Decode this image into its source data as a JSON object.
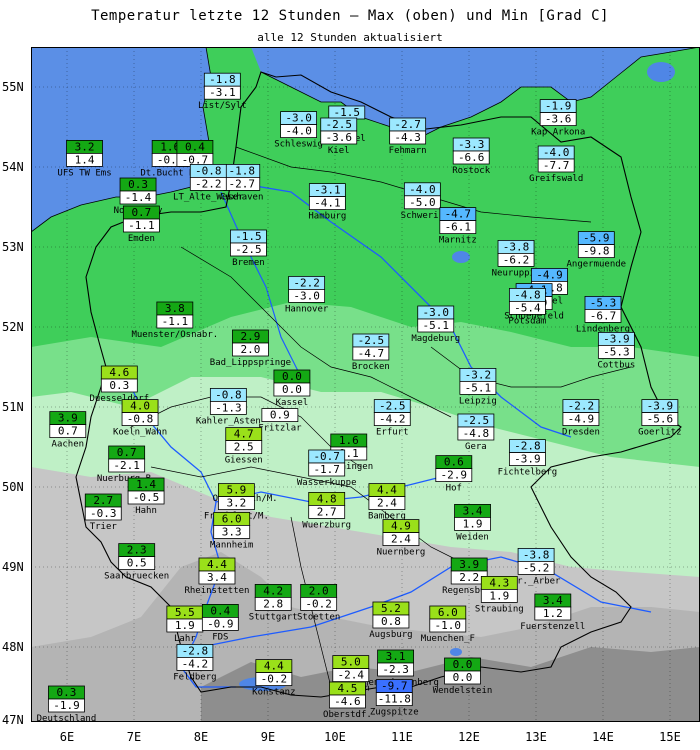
{
  "title": "Temperatur letzte 12 Stunden — Max (oben) und Min [Grad C]",
  "subtitle": "alle 12 Stunden aktualisiert",
  "lat_labels": [
    "55N",
    "54N",
    "53N",
    "52N",
    "51N",
    "50N",
    "49N",
    "48N",
    "47N"
  ],
  "lon_labels": [
    "6E",
    "7E",
    "8E",
    "9E",
    "10E",
    "11E",
    "12E",
    "13E",
    "14E",
    "15E"
  ],
  "colors": {
    "sea": "#5b8fe6",
    "land_green": "#3fce5a",
    "land_green_light": "#78e08a",
    "land_pale": "#bff0c6",
    "land_grey": "#c6c6c6",
    "land_dark": "#8e8e8e",
    "lake": "#4f86e6",
    "border": "#000000",
    "river": "#1e5cff",
    "max_bg_warm_strong": "#14a814",
    "max_bg_warm": "#9ae01a",
    "max_bg_cold": "#9ce8ff",
    "max_bg_colder": "#55b8ff",
    "max_bg_coldest": "#3a70ff"
  },
  "stations": [
    {
      "name": "List/Sylt",
      "max": "-1.8",
      "min": "-3.1",
      "cat": "cold",
      "lon": 8.41,
      "lat": 55.01
    },
    {
      "name": "UFS TW Ems",
      "max": "3.2",
      "min": "1.4",
      "cat": "warm_strong",
      "lon": 6.35,
      "lat": 54.17
    },
    {
      "name": "Dt.Bucht H.",
      "max": "1.6",
      "min": "-0.2",
      "cat": "warm_strong",
      "lon": 7.63,
      "lat": 54.17
    },
    {
      "name": "",
      "max": "0.4",
      "min": "-0.7",
      "cat": "warm_strong",
      "lon": 8.0,
      "lat": 54.17
    },
    {
      "name": "Schleswig",
      "max": "-3.0",
      "min": "-4.0",
      "cat": "cold",
      "lon": 9.55,
      "lat": 54.53
    },
    {
      "name": "LT_Kiel",
      "max": "-1.5",
      "min": "",
      "cat": "cold",
      "lon": 10.27,
      "lat": 54.6
    },
    {
      "name": "Kiel",
      "max": "-2.5",
      "min": "-3.6",
      "cat": "cold",
      "lon": 10.15,
      "lat": 54.45
    },
    {
      "name": "Fehmarn",
      "max": "-2.7",
      "min": "-4.3",
      "cat": "cold",
      "lon": 11.18,
      "lat": 54.45
    },
    {
      "name": "Kap Arkona",
      "max": "-1.9",
      "min": "-3.6",
      "cat": "cold",
      "lon": 13.43,
      "lat": 54.68
    },
    {
      "name": "Rostock",
      "max": "-3.3",
      "min": "-6.6",
      "cat": "cold",
      "lon": 12.13,
      "lat": 54.2
    },
    {
      "name": "Greifswald",
      "max": "-4.0",
      "min": "-7.7",
      "cat": "cold",
      "lon": 13.4,
      "lat": 54.1
    },
    {
      "name": "Cuxhaven",
      "max": "-1.8",
      "min": "-2.7",
      "cat": "cold",
      "lon": 8.7,
      "lat": 53.87
    },
    {
      "name": "LT_Alte_Weser",
      "max": "-0.8",
      "min": "-2.2",
      "cat": "cold",
      "lon": 8.2,
      "lat": 53.87
    },
    {
      "name": "Norderney",
      "max": "0.3",
      "min": "-1.4",
      "cat": "warm_strong",
      "lon": 7.15,
      "lat": 53.7
    },
    {
      "name": "Emden",
      "max": "0.7",
      "min": "-1.1",
      "cat": "warm_strong",
      "lon": 7.2,
      "lat": 53.35
    },
    {
      "name": "Hamburg",
      "max": "-3.1",
      "min": "-4.1",
      "cat": "cold",
      "lon": 9.98,
      "lat": 53.63
    },
    {
      "name": "Schwerin",
      "max": "-4.0",
      "min": "-5.0",
      "cat": "cold",
      "lon": 11.4,
      "lat": 53.64
    },
    {
      "name": "Marnitz",
      "max": "-4.7",
      "min": "-6.1",
      "cat": "colder",
      "lon": 11.93,
      "lat": 53.33
    },
    {
      "name": "Neuruppin",
      "max": "-3.8",
      "min": "-6.2",
      "cat": "cold",
      "lon": 12.8,
      "lat": 52.92
    },
    {
      "name": "Angermuende",
      "max": "-5.9",
      "min": "-9.8",
      "cat": "colder",
      "lon": 14.0,
      "lat": 53.03
    },
    {
      "name": "Bremen",
      "max": "-1.5",
      "min": "-2.5",
      "cat": "cold",
      "lon": 8.8,
      "lat": 53.05
    },
    {
      "name": "Tegel",
      "max": "-4.9",
      "min": "-5.8",
      "cat": "colder",
      "lon": 13.3,
      "lat": 52.57
    },
    {
      "name": "Schoenefeld",
      "max": "-4.1",
      "min": "-5.9",
      "cat": "colder",
      "lon": 13.07,
      "lat": 52.38
    },
    {
      "name": "Potsdam",
      "max": "-4.8",
      "min": "-5.4",
      "cat": "cold",
      "lon": 12.97,
      "lat": 52.32
    },
    {
      "name": "Lindenberg",
      "max": "-5.3",
      "min": "-6.7",
      "cat": "colder",
      "lon": 14.1,
      "lat": 52.22
    },
    {
      "name": "Hannover",
      "max": "-2.2",
      "min": "-3.0",
      "cat": "cold",
      "lon": 9.67,
      "lat": 52.47
    },
    {
      "name": "Muenster/Osnabr.",
      "max": "3.8",
      "min": "-1.1",
      "cat": "warm_strong",
      "lon": 7.7,
      "lat": 52.15
    },
    {
      "name": "Bad_Lippspringe",
      "max": "2.9",
      "min": "2.0",
      "cat": "warm_strong",
      "lon": 8.83,
      "lat": 51.8
    },
    {
      "name": "Magdeburg",
      "max": "-3.0",
      "min": "-5.1",
      "cat": "cold",
      "lon": 11.6,
      "lat": 52.1
    },
    {
      "name": "Brocken",
      "max": "-2.5",
      "min": "-4.7",
      "cat": "cold",
      "lon": 10.63,
      "lat": 51.75
    },
    {
      "name": "Cottbus",
      "max": "-3.9",
      "min": "-5.3",
      "cat": "cold",
      "lon": 14.3,
      "lat": 51.77
    },
    {
      "name": "Duesseldorf",
      "max": "4.6",
      "min": "0.3",
      "cat": "warm",
      "lon": 6.87,
      "lat": 51.35
    },
    {
      "name": "Kassel",
      "max": "0.0",
      "min": "0.0",
      "cat": "warm_strong",
      "lon": 9.45,
      "lat": 51.3
    },
    {
      "name": "Leipzig",
      "max": "-3.2",
      "min": "-5.1",
      "cat": "cold",
      "lon": 12.23,
      "lat": 51.32
    },
    {
      "name": "Koeln_Wahn",
      "max": "4.0",
      "min": "-0.8",
      "cat": "warm",
      "lon": 7.18,
      "lat": 50.93
    },
    {
      "name": "Kahler_Asten",
      "max": "-0.8",
      "min": "-1.3",
      "cat": "cold",
      "lon": 8.5,
      "lat": 51.07
    },
    {
      "name": "Fritzlar",
      "max": "",
      "min": "0.9",
      "cat": "warm_strong",
      "lon": 9.27,
      "lat": 50.98
    },
    {
      "name": "Erfurt",
      "max": "-2.5",
      "min": "-4.2",
      "cat": "cold",
      "lon": 10.95,
      "lat": 50.93
    },
    {
      "name": "Dresden",
      "max": "-2.2",
      "min": "-4.9",
      "cat": "cold",
      "lon": 13.77,
      "lat": 50.93
    },
    {
      "name": "Goerlitz",
      "max": "-3.9",
      "min": "-5.6",
      "cat": "cold",
      "lon": 14.95,
      "lat": 50.93
    },
    {
      "name": "Aachen",
      "max": "3.9",
      "min": "0.7",
      "cat": "warm_strong",
      "lon": 6.1,
      "lat": 50.78
    },
    {
      "name": "Giessen",
      "max": "4.7",
      "min": "2.5",
      "cat": "warm",
      "lon": 8.73,
      "lat": 50.58
    },
    {
      "name": "Meiningen",
      "max": "1.6",
      "min": "0.1",
      "cat": "warm_strong",
      "lon": 10.3,
      "lat": 50.5
    },
    {
      "name": "Gera",
      "max": "-2.5",
      "min": "-4.8",
      "cat": "cold",
      "lon": 12.2,
      "lat": 50.75
    },
    {
      "name": "Nuerburg_B.",
      "max": "0.7",
      "min": "-2.1",
      "cat": "warm_strong",
      "lon": 6.98,
      "lat": 50.35
    },
    {
      "name": "Offenbach/M.",
      "max": "",
      "min": "",
      "cat": "warm",
      "lon": 8.75,
      "lat": 50.1
    },
    {
      "name": "Wasserkuppe",
      "max": "-0.7",
      "min": "-1.7",
      "cat": "cold",
      "lon": 9.97,
      "lat": 50.3
    },
    {
      "name": "Fichtelberg",
      "max": "-2.8",
      "min": "-3.9",
      "cat": "cold",
      "lon": 12.97,
      "lat": 50.43
    },
    {
      "name": "Hof",
      "max": "0.6",
      "min": "-2.9",
      "cat": "warm_strong",
      "lon": 11.87,
      "lat": 50.23
    },
    {
      "name": "Bamberg",
      "max": "4.4",
      "min": "2.4",
      "cat": "warm",
      "lon": 10.87,
      "lat": 49.88
    },
    {
      "name": "Frankfurt/M.",
      "max": "5.9",
      "min": "3.2",
      "cat": "warm",
      "lon": 8.62,
      "lat": 49.88
    },
    {
      "name": "Hahn",
      "max": "1.4",
      "min": "-0.5",
      "cat": "warm_strong",
      "lon": 7.27,
      "lat": 49.95
    },
    {
      "name": "Trier",
      "max": "2.7",
      "min": "-0.3",
      "cat": "warm_strong",
      "lon": 6.63,
      "lat": 49.75
    },
    {
      "name": "Wuerzburg",
      "max": "4.8",
      "min": "2.7",
      "cat": "warm",
      "lon": 9.97,
      "lat": 49.77
    },
    {
      "name": "Weiden",
      "max": "3.4",
      "min": "1.9",
      "cat": "warm_strong",
      "lon": 12.15,
      "lat": 49.62
    },
    {
      "name": "Mannheim",
      "max": "6.0",
      "min": "3.3",
      "cat": "warm",
      "lon": 8.55,
      "lat": 49.52
    },
    {
      "name": "Nuernberg",
      "max": "4.9",
      "min": "2.4",
      "cat": "warm",
      "lon": 11.08,
      "lat": 49.43
    },
    {
      "name": "Saarbruecken",
      "max": "2.3",
      "min": "0.5",
      "cat": "warm_strong",
      "lon": 7.13,
      "lat": 49.13
    },
    {
      "name": "Gr._Arber",
      "max": "-3.8",
      "min": "-5.2",
      "cat": "cold",
      "lon": 13.1,
      "lat": 49.07
    },
    {
      "name": "Regensburg",
      "max": "3.9",
      "min": "2.2",
      "cat": "warm_strong",
      "lon": 12.1,
      "lat": 48.95
    },
    {
      "name": "Rheinstetten",
      "max": "4.4",
      "min": "3.4",
      "cat": "warm",
      "lon": 8.33,
      "lat": 48.95
    },
    {
      "name": "Straubing",
      "max": "4.3",
      "min": "1.9",
      "cat": "warm",
      "lon": 12.55,
      "lat": 48.72
    },
    {
      "name": "Stuttgart",
      "max": "4.2",
      "min": "2.8",
      "cat": "warm_strong",
      "lon": 9.17,
      "lat": 48.62
    },
    {
      "name": "Stoetten",
      "max": "2.0",
      "min": "-0.2",
      "cat": "warm_strong",
      "lon": 9.85,
      "lat": 48.62
    },
    {
      "name": "Fuerstenzell",
      "max": "3.4",
      "min": "1.2",
      "cat": "warm_strong",
      "lon": 13.35,
      "lat": 48.5
    },
    {
      "name": "Lahr",
      "max": "5.5",
      "min": "1.9",
      "cat": "warm",
      "lon": 7.85,
      "lat": 48.35
    },
    {
      "name": "FDS",
      "max": "0.4",
      "min": "-0.9",
      "cat": "warm_strong",
      "lon": 8.38,
      "lat": 48.37
    },
    {
      "name": "Augsburg",
      "max": "5.2",
      "min": "0.8",
      "cat": "warm",
      "lon": 10.93,
      "lat": 48.4
    },
    {
      "name": "Muenchen_F",
      "max": "6.0",
      "min": "-1.0",
      "cat": "warm",
      "lon": 11.78,
      "lat": 48.35
    },
    {
      "name": "Feldberg",
      "max": "-2.8",
      "min": "-4.2",
      "cat": "cold",
      "lon": 8.0,
      "lat": 47.87
    },
    {
      "name": "Hohenpeissenberg",
      "max": "3.1",
      "min": "-2.3",
      "cat": "warm_strong",
      "lon": 11.0,
      "lat": 47.8
    },
    {
      "name": "Konstanz",
      "max": "4.4",
      "min": "-0.2",
      "cat": "warm",
      "lon": 9.18,
      "lat": 47.68
    },
    {
      "name": "Kempten",
      "max": "5.0",
      "min": "-2.4",
      "cat": "warm",
      "lon": 10.33,
      "lat": 47.73
    },
    {
      "name": "Wendelstein",
      "max": "0.0",
      "min": "0.0",
      "cat": "warm_strong",
      "lon": 12.0,
      "lat": 47.7
    },
    {
      "name": "Oberstdf.",
      "max": "4.5",
      "min": "-4.6",
      "cat": "warm",
      "lon": 10.28,
      "lat": 47.4
    },
    {
      "name": "Zugspitze",
      "max": "-9.7",
      "min": "-11.8",
      "cat": "coldest",
      "lon": 10.98,
      "lat": 47.43
    },
    {
      "name": "Deutschland",
      "max": "0.3",
      "min": "-1.9",
      "cat": "warm_strong",
      "lon": 6.08,
      "lat": 47.35
    }
  ]
}
